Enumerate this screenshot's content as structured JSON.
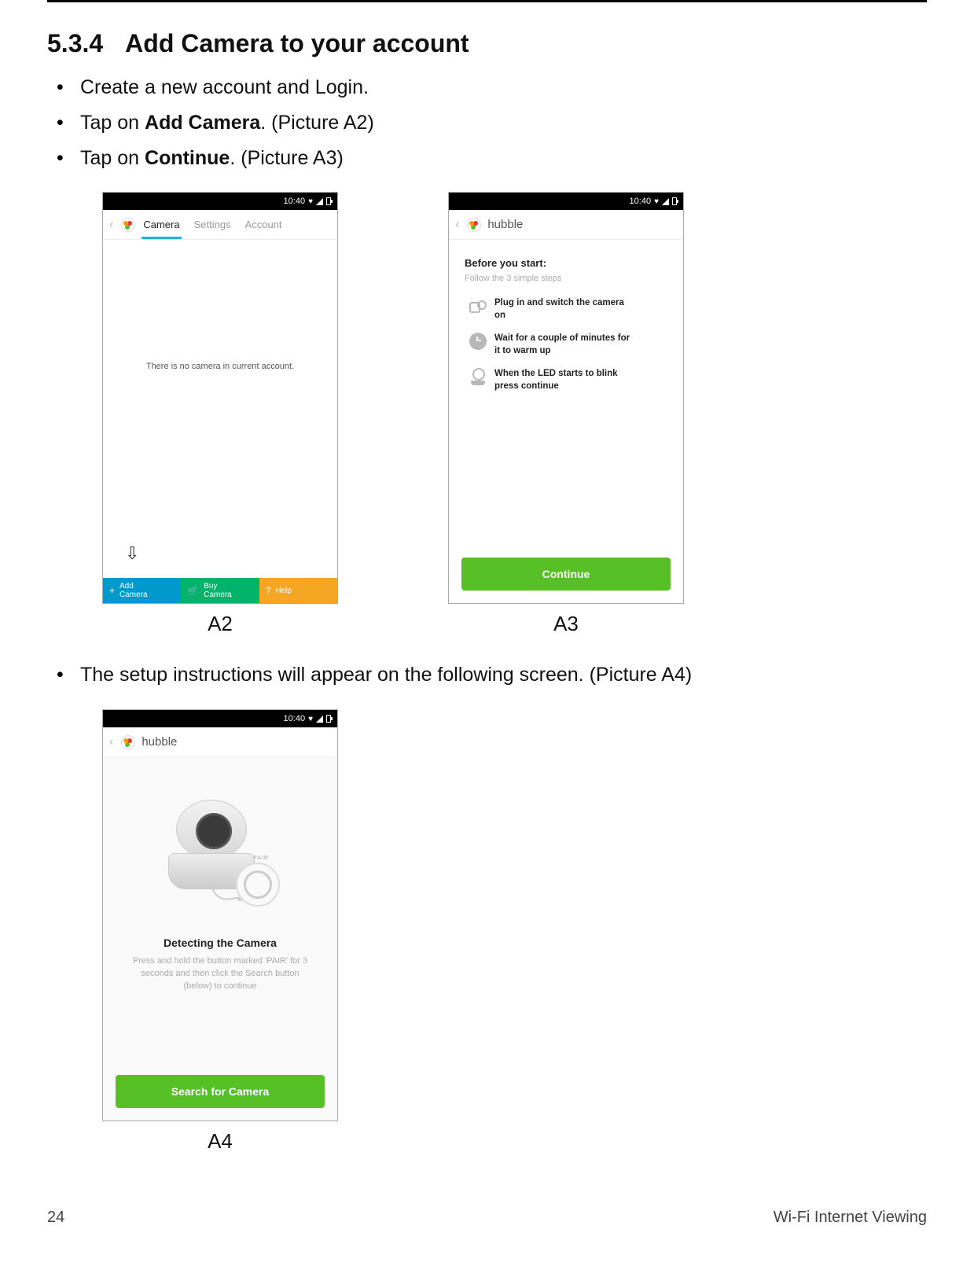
{
  "section": {
    "number": "5.3.4",
    "title": "Add Camera to your account"
  },
  "bullets_top": [
    {
      "text": "Create a new account and Login."
    },
    {
      "pre": "Tap on ",
      "bold": "Add Camera",
      "post": ". (Picture A2)"
    },
    {
      "pre": "Tap on ",
      "bold": "Continue",
      "post": ". (Picture A3)"
    }
  ],
  "bullets_mid": [
    {
      "text": "The setup instructions will appear on the following screen. (Picture A4)"
    }
  ],
  "status_time": "10:40",
  "a2": {
    "tabs": {
      "camera": "Camera",
      "settings": "Settings",
      "account": "Account"
    },
    "empty_msg": "There is no camera in current account.",
    "bottom": {
      "add": {
        "l1": "Add",
        "l2": "Camera"
      },
      "buy": {
        "l1": "Buy",
        "l2": "Camera"
      },
      "help": "Help"
    },
    "caption": "A2"
  },
  "a3": {
    "brand": "hubble",
    "before_title": "Before you start:",
    "before_sub": "Follow the 3 simple steps",
    "steps": [
      "Plug in and switch the camera on",
      "Wait for a couple of minutes for it to warm up",
      "When the LED starts to blink press continue"
    ],
    "continue_btn": "Continue",
    "caption": "A3"
  },
  "a4": {
    "brand": "hubble",
    "pair_label": "PAIR",
    "detect_title": "Detecting the Camera",
    "detect_sub": "Press and hold the button marked 'PAIR' for 3 seconds and then click the Search button (below) to continue",
    "search_btn": "Search for Camera",
    "caption": "A4"
  },
  "footer": {
    "page": "24",
    "section_name": "Wi-Fi Internet Viewing"
  }
}
